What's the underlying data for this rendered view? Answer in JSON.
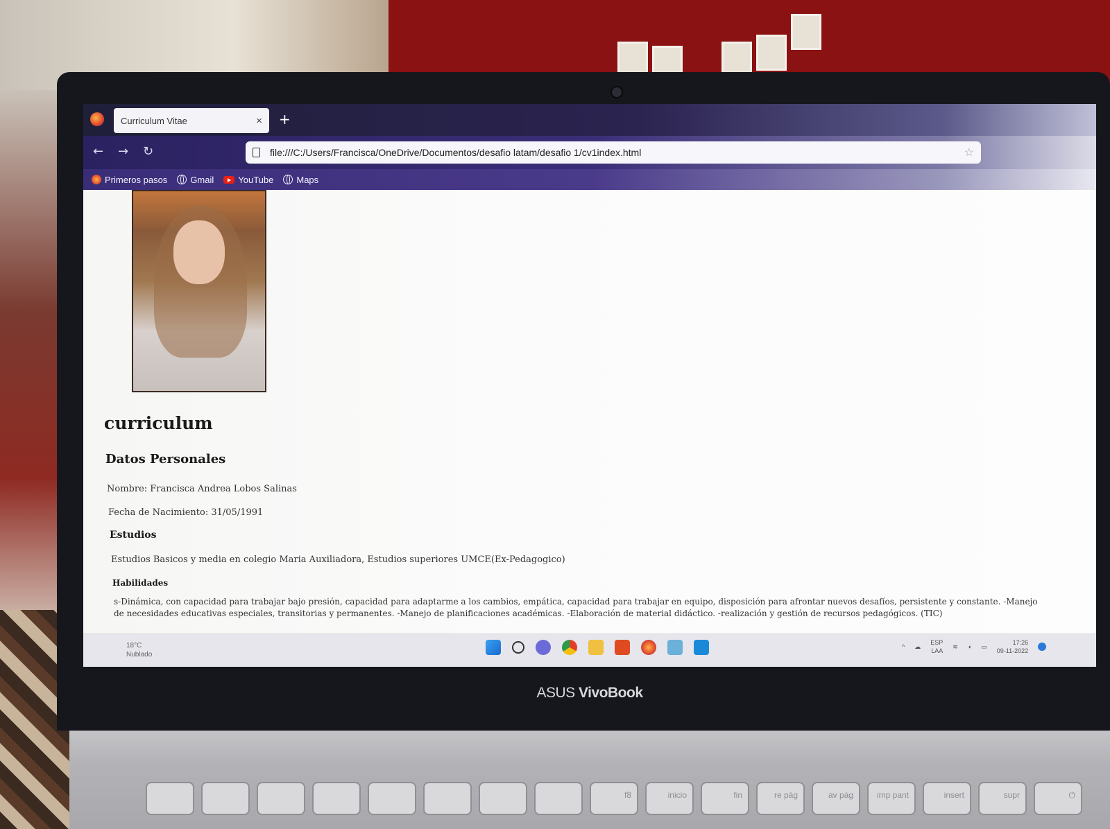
{
  "browser": {
    "tab_title": "Curriculum Vitae",
    "tab_close": "×",
    "new_tab": "+",
    "url": "file:///C:/Users/Francisca/OneDrive/Documentos/desafio latam/desafio 1/cv1index.html",
    "nav": {
      "back": "←",
      "forward": "→",
      "reload": "↻"
    },
    "star": "☆",
    "bookmarks": [
      {
        "label": "Primeros pasos",
        "icon": "firefox-icon"
      },
      {
        "label": "Gmail",
        "icon": "globe-icon"
      },
      {
        "label": "YouTube",
        "icon": "youtube-icon"
      },
      {
        "label": "Maps",
        "icon": "globe-icon"
      }
    ]
  },
  "page": {
    "title": "curriculum",
    "personal_heading": "Datos Personales",
    "name_line": "Nombre: Francisca Andrea Lobos Salinas",
    "birth_line": "Fecha de Nacimiento: 31/05/1991",
    "studies_heading": "Estudios",
    "studies_text": "Estudios Basicos y media en colegio Maria Auxiliadora, Estudios superiores UMCE(Ex-Pedagogico)",
    "skills_heading": "Habilidades",
    "skills_text": "s-Dinámica, con capacidad para trabajar bajo presión, capacidad para adaptarme a los cambios, empática, capacidad para trabajar en equipo, disposición para afrontar nuevos desafíos, persistente y constante. -Manejo de necesidades educativas especiales, transitorias y permanentes. -Manejo de planificaciones académicas. -Elaboración de material didáctico. -realización y gestión de recursos pedagógicos. (TIC)"
  },
  "taskbar": {
    "weather_temp": "18°C",
    "weather_desc": "Nublado",
    "lang_top": "ESP",
    "lang_bottom": "LAA",
    "time": "17:26",
    "date": "09-11-2022",
    "apps": [
      "windows-start-icon",
      "search-icon",
      "chat-icon",
      "chrome-icon",
      "file-explorer-icon",
      "office-icon",
      "firefox-icon",
      "app-icon",
      "vscode-icon"
    ]
  },
  "laptop": {
    "brand_prefix": "ASUS ",
    "brand_name": "VivoBook",
    "keys": [
      "",
      "",
      "",
      "",
      "",
      "",
      "",
      "",
      "f8",
      "inicio",
      "fin",
      "re pág",
      "av pág",
      "imp pant",
      "insert",
      "supr",
      "⏻"
    ]
  },
  "colors": {
    "browser_gradient_start": "#2a2260",
    "page_bg": "#fbfbfb",
    "accent_blue": "#2a7ad8"
  }
}
